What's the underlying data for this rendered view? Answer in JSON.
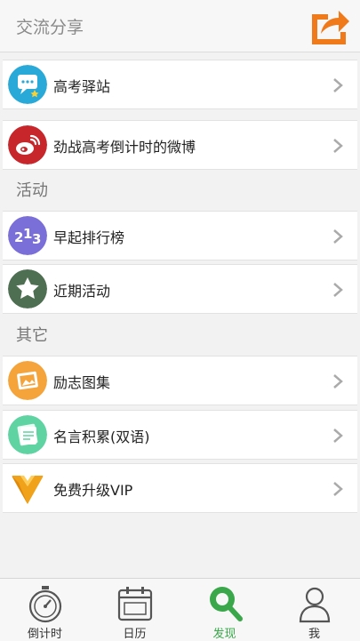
{
  "header": {
    "title": "交流分享",
    "share_icon": "share-icon"
  },
  "sections": [
    {
      "title": ""
    },
    {
      "title": "活动"
    },
    {
      "title": "其它"
    }
  ],
  "items": [
    {
      "label": "高考驿站",
      "icon": "chat-bubble-icon",
      "color": "#29a9d8"
    },
    {
      "label": "劲战高考倒计时的微博",
      "icon": "weibo-icon",
      "color": "#c7262b"
    },
    {
      "label": "早起排行榜",
      "icon": "ranking-icon",
      "color": "#7a6fd9"
    },
    {
      "label": "近期活动",
      "icon": "star-icon",
      "color": "#4f6f52"
    },
    {
      "label": "励志图集",
      "icon": "gallery-icon",
      "color": "#f4a43a"
    },
    {
      "label": "名言积累(双语)",
      "icon": "notes-icon",
      "color": "#5fd3a2"
    },
    {
      "label": "免费升级VIP",
      "icon": "vip-badge-icon",
      "color": "#f1a21b"
    }
  ],
  "tabs": [
    {
      "label": "倒计时",
      "icon": "stopwatch-icon",
      "active": false
    },
    {
      "label": "日历",
      "icon": "calendar-icon",
      "active": false
    },
    {
      "label": "发现",
      "icon": "discover-search-icon",
      "active": true
    },
    {
      "label": "我",
      "icon": "user-icon",
      "active": false
    }
  ],
  "colors": {
    "accent": "#3aa84a",
    "share": "#f07a1a"
  }
}
